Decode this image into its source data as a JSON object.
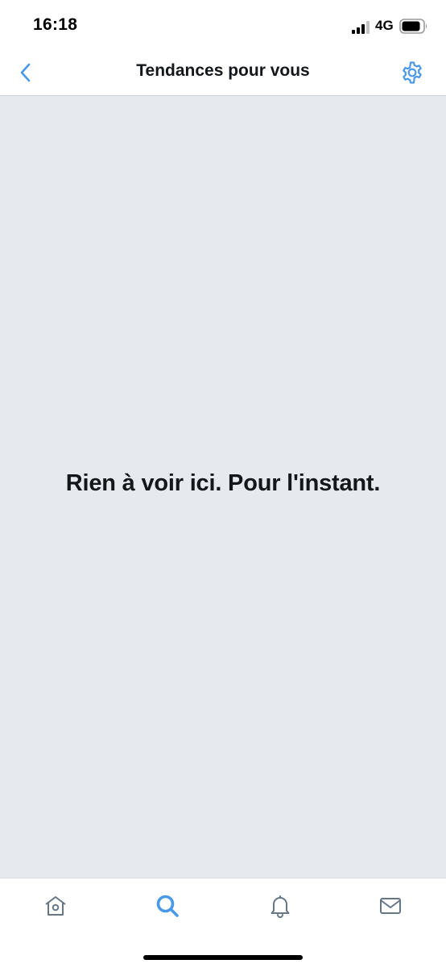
{
  "status_bar": {
    "time": "16:18",
    "network": "4G",
    "signal_icon": "cellular-signal-icon",
    "battery_icon": "battery-icon"
  },
  "nav": {
    "back_icon": "chevron-left-icon",
    "title": "Tendances pour vous",
    "settings_icon": "gear-icon"
  },
  "main": {
    "empty_message": "Rien à voir ici. Pour l'instant."
  },
  "tab_bar": {
    "tabs": [
      {
        "icon": "home-icon",
        "active": false
      },
      {
        "icon": "search-icon",
        "active": true
      },
      {
        "icon": "bell-icon",
        "active": false
      },
      {
        "icon": "envelope-icon",
        "active": false
      }
    ]
  },
  "colors": {
    "accent": "#4a99e9",
    "text_primary": "#14171a",
    "background": "#e6e9ee",
    "icon_inactive": "#657786"
  }
}
